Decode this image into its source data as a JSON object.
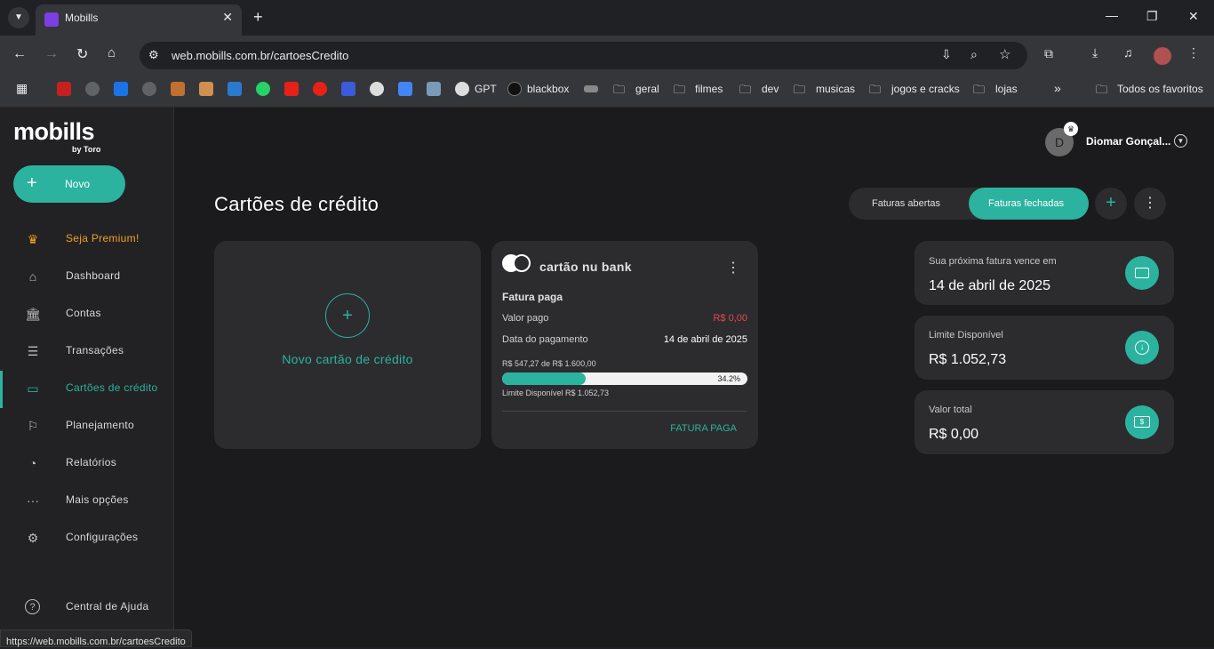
{
  "browser": {
    "tab_title": "Mobills",
    "url": "web.mobills.com.br/cartoesCredito",
    "status_url": "https://web.mobills.com.br/cartoesCredito",
    "bookmarks": [
      "GPT",
      "blackbox",
      "geral",
      "filmes",
      "dev",
      "musicas",
      "jogos e cracks",
      "lojas"
    ],
    "all_favorites": "Todos os favoritos"
  },
  "brand": {
    "logo": "mobills",
    "sub": "by Toro"
  },
  "sidebar": {
    "new_label": "Novo",
    "items": [
      {
        "label": "Seja Premium!",
        "icon": "crown-icon"
      },
      {
        "label": "Dashboard",
        "icon": "home-icon"
      },
      {
        "label": "Contas",
        "icon": "bank-icon"
      },
      {
        "label": "Transações",
        "icon": "list-icon"
      },
      {
        "label": "Cartões de crédito",
        "icon": "card-icon"
      },
      {
        "label": "Planejamento",
        "icon": "flag-icon"
      },
      {
        "label": "Relatórios",
        "icon": "pie-icon"
      },
      {
        "label": "Mais opções",
        "icon": "dots-icon"
      },
      {
        "label": "Configurações",
        "icon": "gear-icon"
      },
      {
        "label": "Central de Ajuda",
        "icon": "help-icon"
      }
    ]
  },
  "user": {
    "initial": "D",
    "name": "Diomar Gonçal..."
  },
  "page": {
    "title": "Cartões de crédito",
    "toggle_open": "Faturas abertas",
    "toggle_closed": "Faturas fechadas"
  },
  "new_card": {
    "label": "Novo cartão de crédito"
  },
  "credit_card": {
    "name": "cartão nu bank",
    "status_title": "Fatura paga",
    "paid_label": "Valor pago",
    "paid_value": "R$ 0,00",
    "date_label": "Data do pagamento",
    "date_value": "14 de abril de 2025",
    "usage_text": "R$ 547,27 de R$ 1.600,00",
    "usage_percent_label": "34.2%",
    "usage_fraction": 0.342,
    "available_text": "Limite Disponível R$ 1.052,73",
    "action": "FATURA PAGA"
  },
  "summary": [
    {
      "label": "Sua próxima fatura vence em",
      "value": "14 de abril de 2025",
      "icon": "card-icon"
    },
    {
      "label": "Limite Disponível",
      "value": "R$ 1.052,73",
      "icon": "money-down-icon"
    },
    {
      "label": "Valor total",
      "value": "R$ 0,00",
      "icon": "cash-icon"
    }
  ],
  "colors": {
    "accent": "#2bb3a0",
    "premium": "#f0a020",
    "negative": "#e5484d"
  }
}
